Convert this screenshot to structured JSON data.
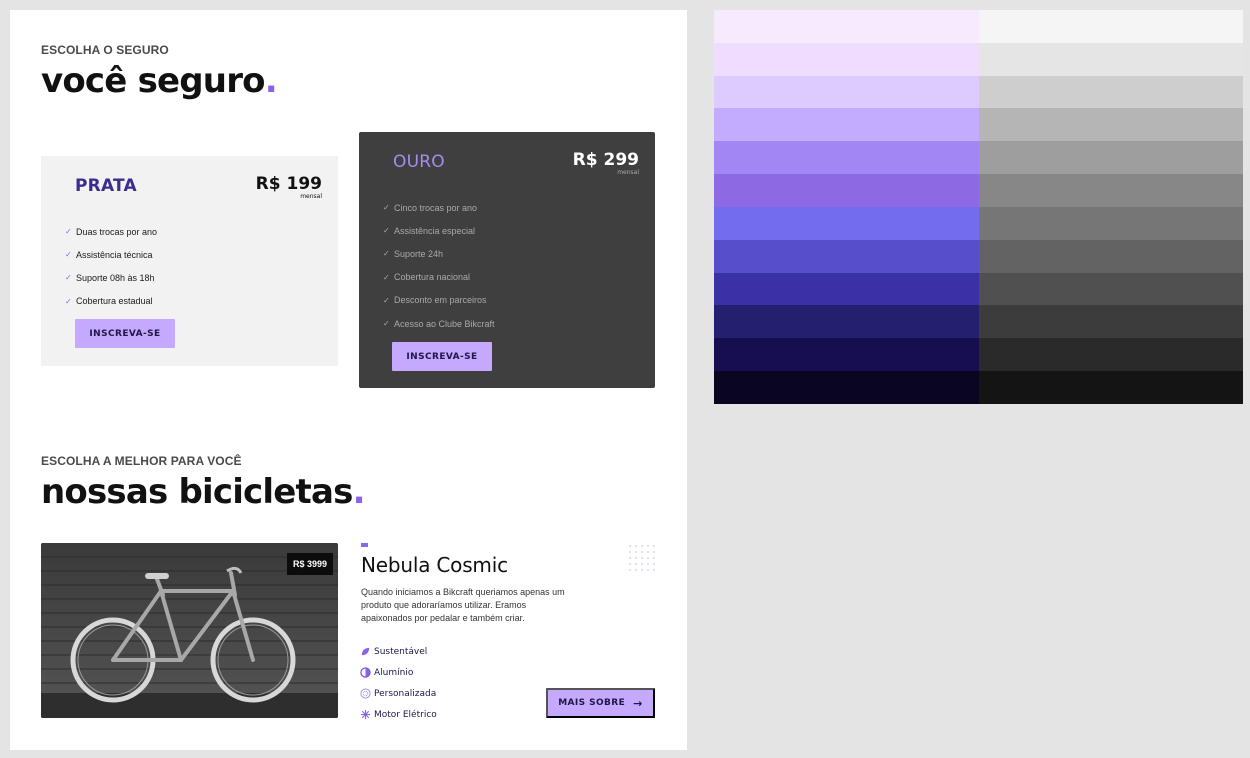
{
  "insurance": {
    "eyebrow": "ESCOLHA O SEGURO",
    "title": "você seguro",
    "title_dot": ".",
    "plans": [
      {
        "name": "PRATA",
        "price": "R$ 199",
        "period": "mensal",
        "features": [
          "Duas trocas por ano",
          "Assistência técnica",
          "Suporte 08h às 18h",
          "Cobertura estadual"
        ],
        "button": "INSCREVA-SE"
      },
      {
        "name": "OURO",
        "price": "R$ 299",
        "period": "mensal",
        "features": [
          "Cinco trocas por ano",
          "Assistência especial",
          "Suporte 24h",
          "Cobertura nacional",
          "Desconto em parceiros",
          "Acesso ao Clube Bikcraft"
        ],
        "button": "INSCREVA-SE"
      }
    ]
  },
  "bikes": {
    "eyebrow": "ESCOLHA A MELHOR PARA VOCÊ",
    "title": "nossas bicicletas",
    "title_dot": ".",
    "product": {
      "name": "Nebula Cosmic",
      "price_tag": "R$ 3999",
      "description": "Quando iniciamos a Bikcraft queriamos apenas um produto que adoraríamos utilizar. Eramos apaixonados por pedalar e também criar.",
      "features": [
        {
          "label": "Sustentável",
          "icon": "leaf-icon"
        },
        {
          "label": "Alumínio",
          "icon": "half-circle-icon"
        },
        {
          "label": "Personalizada",
          "icon": "pattern-icon"
        },
        {
          "label": "Motor Elétrico",
          "icon": "snowflake-icon"
        }
      ],
      "more_button": "MAIS SOBRE",
      "more_arrow": "→"
    }
  },
  "palette": {
    "purples": [
      "#f6eaff",
      "#f0dcfd",
      "#dccbfe",
      "#c3acfd",
      "#a287f4",
      "#8d6ae3",
      "#746cef",
      "#574ecb",
      "#3b31a6",
      "#24206f",
      "#170e4f",
      "#0a0622"
    ],
    "grays": [
      "#f5f5f5",
      "#e5e5e5",
      "#cecece",
      "#b5b5b5",
      "#9e9e9e",
      "#878787",
      "#767676",
      "#636363",
      "#505050",
      "#3c3c3c",
      "#2a2a2a",
      "#141414"
    ]
  }
}
